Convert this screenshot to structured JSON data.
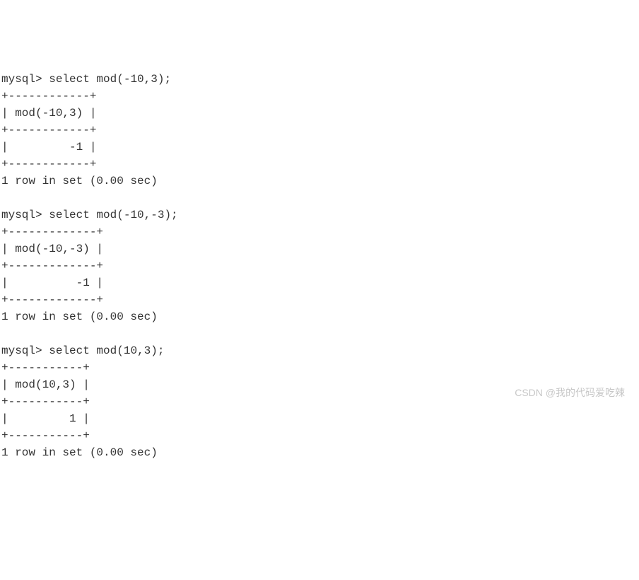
{
  "queries": [
    {
      "prompt": "mysql> ",
      "command": "select mod(-10,3);",
      "border_top": "+------------+",
      "header_row": "| mod(-10,3) |",
      "border_mid": "+------------+",
      "value_row": "|         -1 |",
      "border_bot": "+------------+",
      "status": "1 row in set (0.00 sec)"
    },
    {
      "prompt": "mysql> ",
      "command": "select mod(-10,-3);",
      "border_top": "+-------------+",
      "header_row": "| mod(-10,-3) |",
      "border_mid": "+-------------+",
      "value_row": "|          -1 |",
      "border_bot": "+-------------+",
      "status": "1 row in set (0.00 sec)"
    },
    {
      "prompt": "mysql> ",
      "command": "select mod(10,3);",
      "border_top": "+-----------+",
      "header_row": "| mod(10,3) |",
      "border_mid": "+-----------+",
      "value_row": "|         1 |",
      "border_bot": "+-----------+",
      "status": "1 row in set (0.00 sec)"
    }
  ],
  "watermark": "CSDN @我的代码爱吃辣"
}
